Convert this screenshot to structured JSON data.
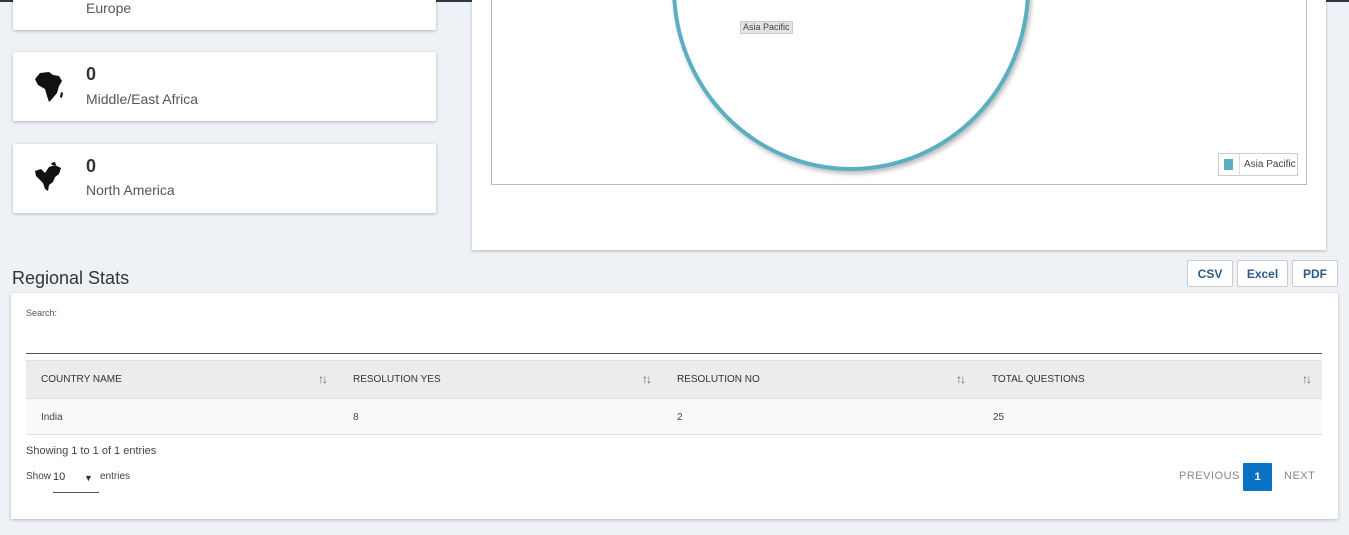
{
  "regions": [
    {
      "name": "Europe",
      "count": "",
      "icon": "europe-map-icon"
    },
    {
      "name": "Middle/East Africa",
      "count": "0",
      "icon": "africa-map-icon"
    },
    {
      "name": "North America",
      "count": "0",
      "icon": "north-america-map-icon"
    }
  ],
  "chart_data": {
    "type": "pie",
    "title": "",
    "slices": [
      {
        "label": "Asia Pacific",
        "value": 100
      }
    ],
    "legend": [
      "Asia Pacific"
    ],
    "legend_position": "bottom-right",
    "colors": [
      "#5ab0c0"
    ]
  },
  "section": {
    "title": "Regional Stats"
  },
  "export_buttons": [
    "CSV",
    "Excel",
    "PDF"
  ],
  "table": {
    "search_label": "Search:",
    "search_value": "",
    "columns": [
      "COUNTRY NAME",
      "RESOLUTION YES",
      "RESOLUTION NO",
      "TOTAL QUESTIONS"
    ],
    "rows": [
      [
        "India",
        "8",
        "2",
        "25"
      ]
    ],
    "info": "Showing 1 to 1 of 1 entries",
    "length": {
      "show": "Show",
      "value": "10",
      "entries": "entries"
    },
    "pagination": {
      "previous": "PREVIOUS",
      "current": "1",
      "next": "NEXT"
    }
  },
  "colors": {
    "accent": "#0a72c4",
    "pie": "#5ab0c0",
    "link": "#2a5a8c"
  }
}
